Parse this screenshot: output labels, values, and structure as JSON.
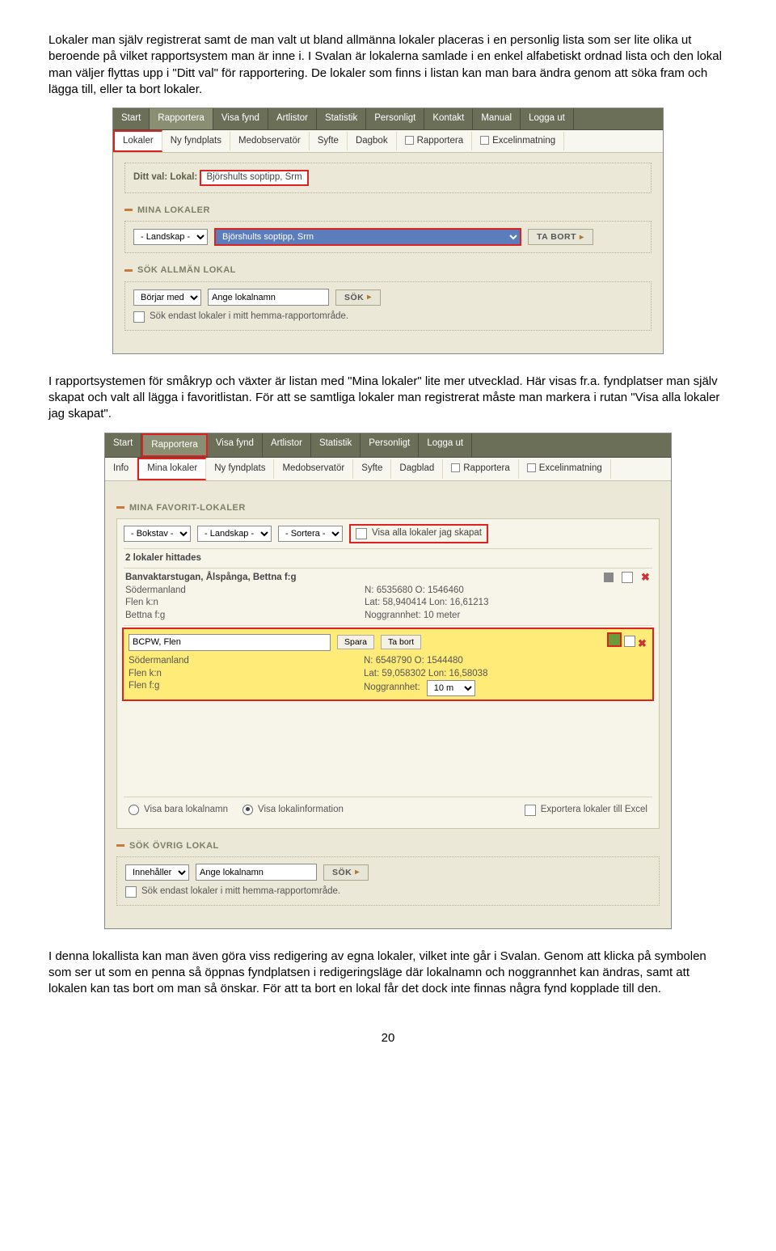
{
  "para1": "Lokaler man själv registrerat samt de man valt ut bland allmänna lokaler placeras i en personlig lista som ser lite olika ut beroende på vilket rapportsystem man är inne i. I Svalan är lokalerna samlade i en enkel alfabetiskt ordnad lista och den lokal man väljer flyttas upp i \"Ditt val\" för rapportering. De lokaler som finns i listan kan man bara ändra genom att söka fram och lägga till, eller ta bort lokaler.",
  "para2": "I rapportsystemen för småkryp och växter är listan med \"Mina lokaler\" lite mer utvecklad. Här visas fr.a. fyndplatser man själv skapat och valt all lägga i favoritlistan. För att se samtliga lokaler man registrerat måste man markera i rutan \"Visa alla lokaler jag skapat\".",
  "para3": "I denna lokallista kan man även göra viss redigering av egna lokaler, vilket inte går i Svalan. Genom att klicka på symbolen som ser ut som en penna så öppnas fyndplatsen i redigeringsläge där lokalnamn och noggrannhet kan ändras, samt att lokalen kan tas bort om man så önskar. För att ta bort en lokal får det dock inte finnas några fynd kopplade till den.",
  "pageNum": "20",
  "app1": {
    "nav": [
      "Start",
      "Rapportera",
      "Visa fynd",
      "Artlistor",
      "Statistik",
      "Personligt",
      "Kontakt",
      "Manual",
      "Logga ut"
    ],
    "sub": [
      "Lokaler",
      "Ny fyndplats",
      "Medobservatör",
      "Syfte",
      "Dagbok",
      "Rapportera",
      "Excelinmatning"
    ],
    "ditt_prefix": "Ditt val:",
    "ditt_label": "Lokal:",
    "ditt_value": "Björshults soptipp, Srm",
    "sec1": "MINA LOKALER",
    "landskap": "- Landskap -",
    "sel_value": "Björshults soptipp, Srm",
    "ta_bort": "TA BORT",
    "sec2": "SÖK ALLMÄN LOKAL",
    "borjar": "Börjar med",
    "ange": "Ange lokalnamn",
    "sok": "SÖK",
    "sok_endast": "Sök endast lokaler i mitt hemma-rapportområde."
  },
  "app2": {
    "nav": [
      "Start",
      "Rapportera",
      "Visa fynd",
      "Artlistor",
      "Statistik",
      "Personligt",
      "Logga ut"
    ],
    "sub": [
      "Info",
      "Mina lokaler",
      "Ny fyndplats",
      "Medobservatör",
      "Syfte",
      "Dagblad",
      "Rapportera",
      "Excelinmatning"
    ],
    "sec_fav": "MINA FAVORIT-LOKALER",
    "bokstav": "- Bokstav -",
    "landskap": "- Landskap -",
    "sortera": "- Sortera -",
    "visa_alla": "Visa alla lokaler jag skapat",
    "found": "2 lokaler hittades",
    "row1": {
      "name": "Banvaktarstugan, Ålspånga, Bettna f:g",
      "a1": "Södermanland",
      "a2": "Flen k:n",
      "a3": "Bettna f:g",
      "c1": "N: 6535680 O: 1546460",
      "c2": "Lat: 58,940414 Lon: 16,61213",
      "c3": "Noggrannhet: 10 meter"
    },
    "row2": {
      "name": "BCPW, Flen",
      "spara": "Spara",
      "tabort": "Ta bort",
      "a1": "Södermanland",
      "a2": "Flen k:n",
      "a3": "Flen f:g",
      "c1": "N: 6548790 O: 1544480",
      "c2": "Lat: 59,058302 Lon: 16,58038",
      "c3l": "Noggrannhet:",
      "acc": "10 m"
    },
    "view_local": "Visa bara lokalnamn",
    "view_info": "Visa lokalinformation",
    "export": "Exportera lokaler till Excel",
    "sec_sok": "SÖK ÖVRIG LOKAL",
    "innehaller": "Innehåller",
    "ange": "Ange lokalnamn",
    "sok": "SÖK",
    "sok_endast": "Sök endast lokaler i mitt hemma-rapportområde."
  }
}
